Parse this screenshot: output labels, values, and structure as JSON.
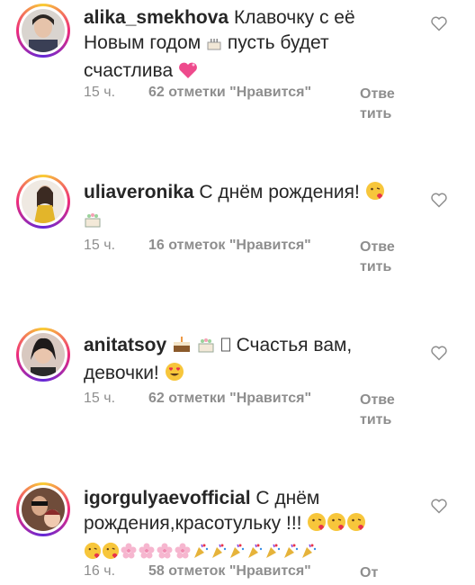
{
  "comments": [
    {
      "username": "alika_smekhova",
      "text_1": "Клавочку с её Новым годом",
      "text_2": "пусть будет счастлива",
      "time": "15 ч.",
      "likes": "62 отметки \"Нравится\"",
      "reply": "Ответить"
    },
    {
      "username": "uliaveronika",
      "text_1": "С днём рождения!",
      "time": "15 ч.",
      "likes": "16 отметок \"Нравится\"",
      "reply": "Ответить"
    },
    {
      "username": "anitatsoy",
      "text_1": "Счастья вам, девочки!",
      "time": "15 ч.",
      "likes": "62 отметки \"Нравится\"",
      "reply": "Ответить"
    },
    {
      "username": "igorgulyaevofficial",
      "text_1": "С днём рождения,красотульку !!!",
      "time": "16 ч.",
      "likes": "58 отметок \"Нравится\"",
      "reply": "От"
    }
  ],
  "icons": {
    "like": "heart-outline-icon"
  },
  "colors": {
    "text": "#262626",
    "meta": "#8e8e8e",
    "story_ring": "#ee2a7b"
  }
}
